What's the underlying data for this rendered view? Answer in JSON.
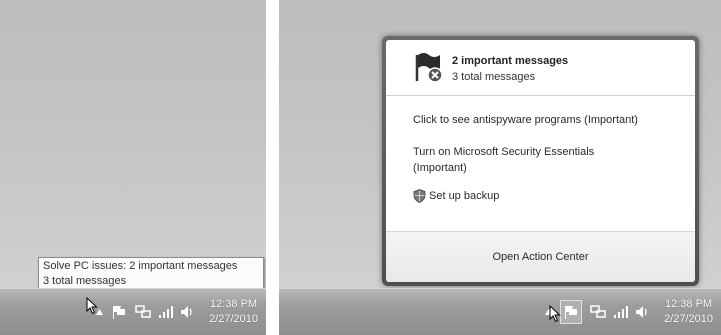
{
  "left": {
    "tooltip": {
      "line1": "Solve PC issues: 2 important messages",
      "line2": "3 total messages"
    },
    "clock": {
      "time": "12:38 PM",
      "date": "2/27/2010"
    }
  },
  "right": {
    "popup": {
      "title": "2 important messages",
      "subtitle": "3 total messages",
      "items": [
        {
          "label": "Click to see antispyware programs (Important)"
        },
        {
          "label_line1": "Turn on Microsoft Security Essentials",
          "label_line2": "(Important)"
        },
        {
          "label": "Set up backup"
        }
      ],
      "footer_link": "Open Action Center"
    },
    "clock": {
      "time": "12:38 PM",
      "date": "2/27/2010"
    }
  },
  "icons": [
    "show-hidden-icons-arrow",
    "action-center-flag-icon",
    "network-icon",
    "signal-bars-icon",
    "volume-icon",
    "shield-icon",
    "mouse-cursor-icon"
  ],
  "colors": {
    "taskbar": "#9a9a9a",
    "popup_border": "#5a5a5a",
    "footer_bg": "#efefef"
  }
}
